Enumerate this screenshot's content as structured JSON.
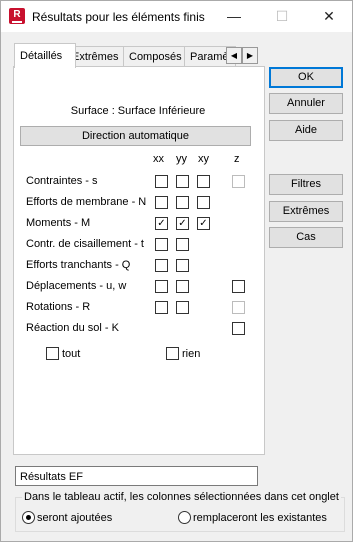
{
  "window": {
    "title": "Résultats pour les éléments finis",
    "icon_letter": "R",
    "minimize": "—",
    "maximize": "☐",
    "close": "✕"
  },
  "tabs": [
    {
      "label": "Détaillés",
      "active": true
    },
    {
      "label": "Extrêmes"
    },
    {
      "label": "Composés"
    },
    {
      "label": "Paramè"
    }
  ],
  "tab_scroll": {
    "left": "◀",
    "right": "▶"
  },
  "panel": {
    "surface_label": "Surface : Surface Inférieure",
    "direction_button": "Direction automatique",
    "columns": [
      "xx",
      "yy",
      "xy",
      "z"
    ],
    "rows": [
      {
        "label": "Contraintes - s",
        "xx": false,
        "yy": false,
        "xy": false,
        "z": "disabled"
      },
      {
        "label": "Efforts de membrane - N",
        "xx": false,
        "yy": false,
        "xy": false,
        "z": "none"
      },
      {
        "label": "Moments - M",
        "xx": true,
        "yy": true,
        "xy": true,
        "z": "none"
      },
      {
        "label": "Contr. de cisaillement - t",
        "xx": false,
        "yy": false,
        "xy": "none",
        "z": "none"
      },
      {
        "label": "Efforts tranchants - Q",
        "xx": false,
        "yy": false,
        "xy": "none",
        "z": "none"
      },
      {
        "label": "Déplacements - u, w",
        "xx": false,
        "yy": false,
        "xy": "none",
        "z": false
      },
      {
        "label": "Rotations - R",
        "xx": false,
        "yy": false,
        "xy": "none",
        "z": "disabled"
      },
      {
        "label": "Réaction du sol - K",
        "xx": "none",
        "yy": "none",
        "xy": "none",
        "z": false
      }
    ],
    "tout_label": "tout",
    "rien_label": "rien",
    "check_mark": "✓"
  },
  "side_buttons": {
    "ok": "OK",
    "annuler": "Annuler",
    "aide": "Aide",
    "filtres": "Filtres",
    "extremes": "Extrêmes",
    "cas": "Cas"
  },
  "result_name": "Résultats EF",
  "group": {
    "legend": "Dans le tableau actif, les colonnes sélectionnées dans cet onglet",
    "option_add": "seront ajoutées",
    "option_replace": "remplaceront les existantes",
    "selected": "add"
  }
}
